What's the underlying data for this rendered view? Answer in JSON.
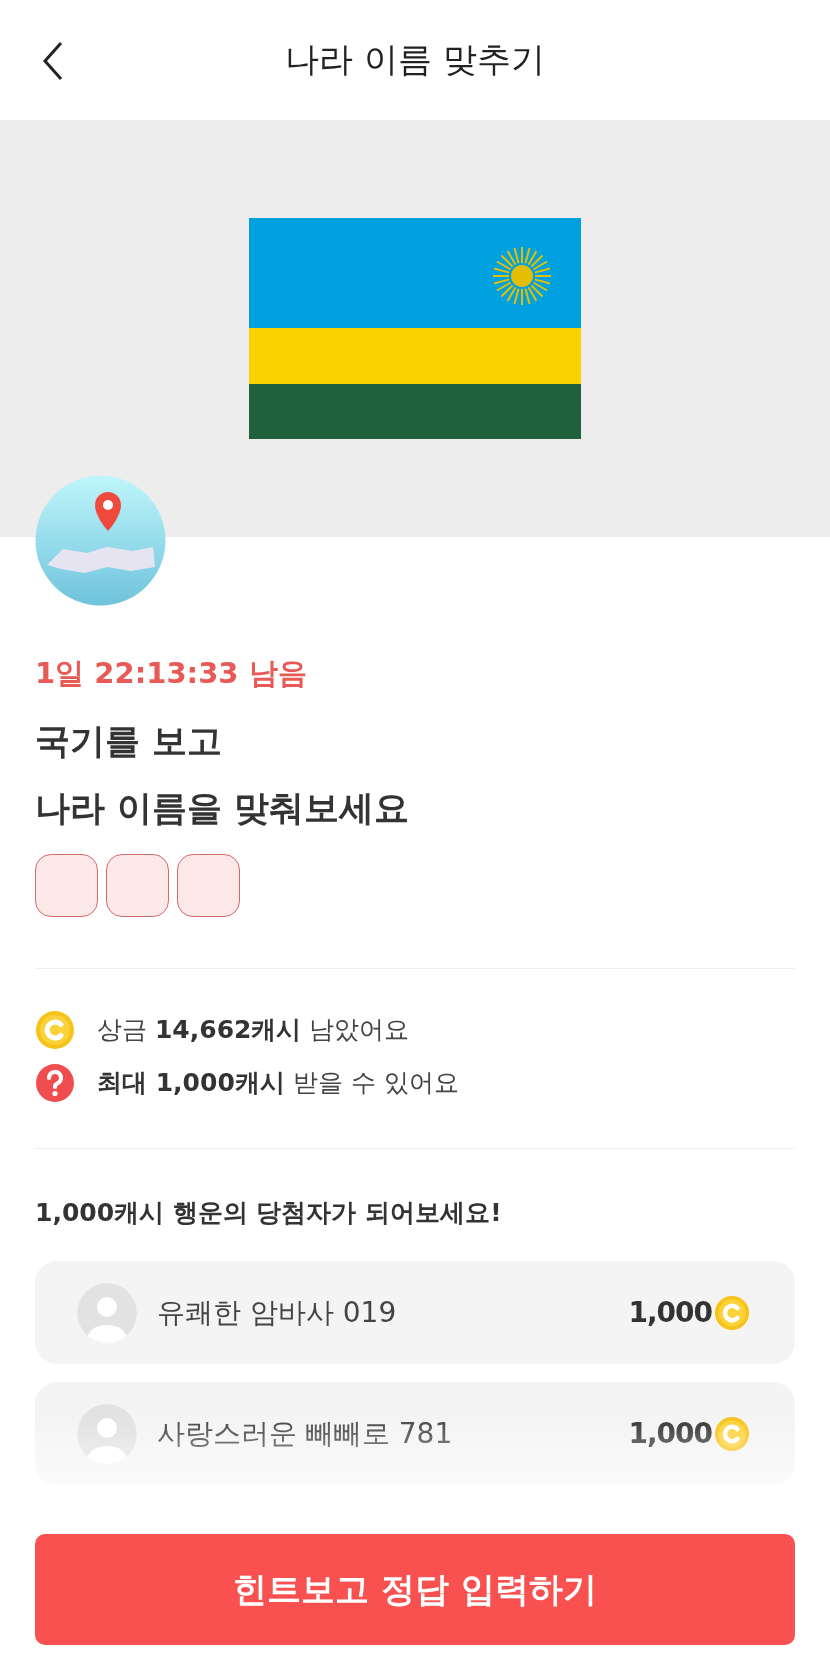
{
  "header": {
    "title": "나라 이름 맞추기"
  },
  "quiz": {
    "time_left": "1일 22:13:33 남음",
    "question_lines": [
      "국기를 보고",
      "나라 이름을 맞춰보세요"
    ],
    "answer_slots": [
      {
        "filled": false
      },
      {
        "filled": false
      },
      {
        "filled": false
      }
    ]
  },
  "info": [
    {
      "kind": "coin",
      "text": "상금 **14,662캐시** 남았어요"
    },
    {
      "kind": "question",
      "text": "**최대 1,000캐시** 받을 수 있어요"
    }
  ],
  "winners": {
    "heading": "1,000캐시 행운의 당첨자가 되어보세요!",
    "items": [
      {
        "name": "유쾌한 암바사 019",
        "amount": "1,000"
      },
      {
        "name": "사랑스러운 빼빼로 781",
        "amount": "1,000"
      }
    ]
  },
  "cta": {
    "label": "힌트보고 정답 입력하기"
  }
}
